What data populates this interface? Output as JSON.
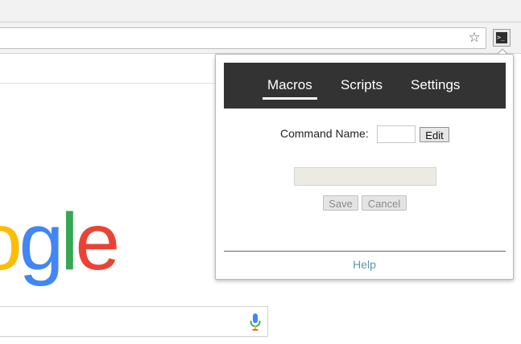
{
  "browser": {
    "star_icon": "☆",
    "extension_icon_label": ">_"
  },
  "logo": {
    "letters": [
      "o",
      "g",
      "l",
      "e"
    ],
    "colors": [
      "#fbbc05",
      "#4285f4",
      "#34a853",
      "#ea4335"
    ]
  },
  "popup": {
    "tabs": [
      {
        "label": "Macros",
        "active": true
      },
      {
        "label": "Scripts",
        "active": false
      },
      {
        "label": "Settings",
        "active": false
      }
    ],
    "command_name_label": "Command Name:",
    "command_name_value": "",
    "edit_label": "Edit",
    "save_label": "Save",
    "cancel_label": "Cancel",
    "help_label": "Help"
  }
}
